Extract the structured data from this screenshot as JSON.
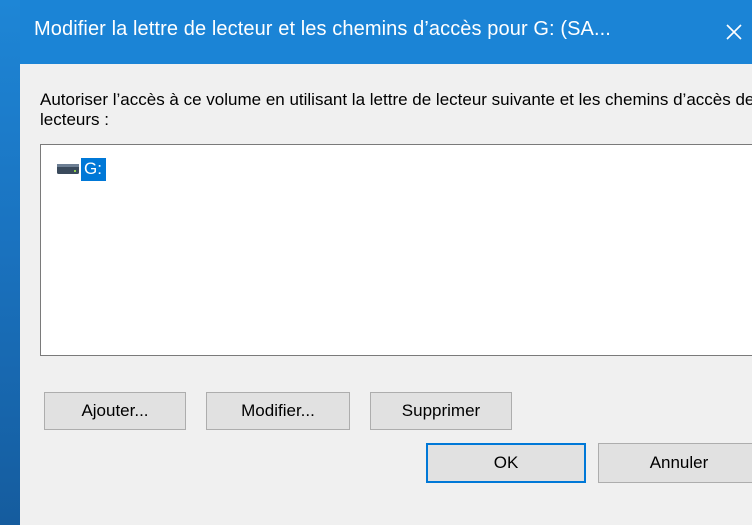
{
  "window": {
    "title": "Modifier la lettre de lecteur et les chemins d’accès pour G: (SA...",
    "close_icon": "close-icon"
  },
  "description": "Autoriser l’accès à ce volume en utilisant la lettre de lecteur suivante et les chemins d’accès de lecteurs :",
  "list": {
    "items": [
      {
        "label": "G:",
        "icon": "drive-icon",
        "selected": true
      }
    ]
  },
  "buttons": {
    "add": "Ajouter...",
    "modify": "Modifier...",
    "delete": "Supprimer",
    "ok": "OK",
    "cancel": "Annuler"
  },
  "colors": {
    "titlebar": "#1b84d6",
    "selection": "#0078d7",
    "dialog_bg": "#f0f0f0"
  }
}
